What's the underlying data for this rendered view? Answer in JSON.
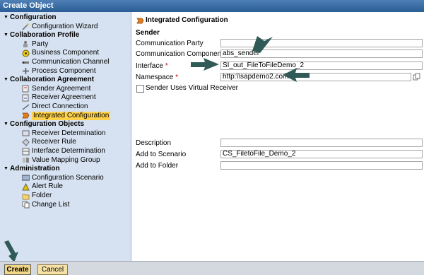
{
  "window": {
    "title": "Create Object"
  },
  "tree": [
    {
      "label": "Configuration",
      "level": 0,
      "icon": "triangle-down"
    },
    {
      "label": "Configuration Wizard",
      "level": 1,
      "icon": "wand-icon"
    },
    {
      "label": "Collaboration Profile",
      "level": 0,
      "icon": "triangle-down"
    },
    {
      "label": "Party",
      "level": 1,
      "icon": "party-icon"
    },
    {
      "label": "Business Component",
      "level": 1,
      "icon": "business-component-icon"
    },
    {
      "label": "Communication Channel",
      "level": 1,
      "icon": "channel-icon"
    },
    {
      "label": "Process Component",
      "level": 1,
      "icon": "process-icon"
    },
    {
      "label": "Collaboration Agreement",
      "level": 0,
      "icon": "triangle-down"
    },
    {
      "label": "Sender Agreement",
      "level": 1,
      "icon": "sender-agreement-icon"
    },
    {
      "label": "Receiver Agreement",
      "level": 1,
      "icon": "receiver-agreement-icon"
    },
    {
      "label": "Direct Connection",
      "level": 1,
      "icon": "direct-connection-icon"
    },
    {
      "label": "Integrated Configuration",
      "level": 1,
      "icon": "integrated-config-icon",
      "selected": true
    },
    {
      "label": "Configuration Objects",
      "level": 0,
      "icon": "triangle-down"
    },
    {
      "label": "Receiver Determination",
      "level": 1,
      "icon": "receiver-determination-icon"
    },
    {
      "label": "Receiver Rule",
      "level": 1,
      "icon": "receiver-rule-icon"
    },
    {
      "label": "Interface Determination",
      "level": 1,
      "icon": "interface-determination-icon"
    },
    {
      "label": "Value Mapping Group",
      "level": 1,
      "icon": "value-mapping-icon"
    },
    {
      "label": "Administration",
      "level": 0,
      "icon": "triangle-down"
    },
    {
      "label": "Configuration Scenario",
      "level": 1,
      "icon": "scenario-icon"
    },
    {
      "label": "Alert Rule",
      "level": 1,
      "icon": "alert-icon"
    },
    {
      "label": "Folder",
      "level": 1,
      "icon": "folder-icon"
    },
    {
      "label": "Change List",
      "level": 1,
      "icon": "change-list-icon"
    }
  ],
  "form": {
    "heading": "Integrated Configuration",
    "section": "Sender",
    "communication_party_label": "Communication Party",
    "communication_party_value": "",
    "communication_component_label": "Communication Component",
    "communication_component_value": "abs_sender",
    "interface_label": "Interface",
    "interface_value": "SI_out_FileToFileDemo_2",
    "namespace_label": "Namespace",
    "namespace_value": "http:\\\\sapdemo2.com",
    "virtual_receiver_label": "Sender Uses Virtual Receiver",
    "virtual_receiver_checked": false,
    "required_marker": "*",
    "description_label": "Description",
    "description_value": "",
    "scenario_label": "Add to Scenario",
    "scenario_value": "CS_FiletoFile_Demo_2",
    "folder_label": "Add to Folder",
    "folder_value": ""
  },
  "buttons": {
    "create": "Create",
    "cancel": "Cancel"
  },
  "colors": {
    "arrow": "#2f5a57",
    "selected": "#ffd24a",
    "required": "#cc0000"
  }
}
